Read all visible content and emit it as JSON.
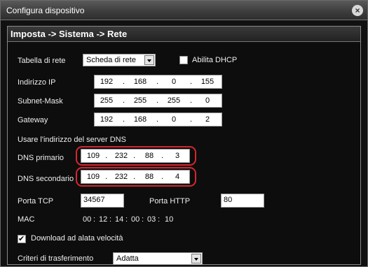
{
  "window": {
    "title": "Configura dispositivo",
    "close_icon": "close-icon"
  },
  "breadcrumb": "Imposta -> Sistema -> Rete",
  "tabella_di_rete": {
    "label": "Tabella di rete",
    "value": "Scheda di rete"
  },
  "dhcp": {
    "label": "Abilita DHCP",
    "checked": false
  },
  "ip": {
    "label": "Indirizzo IP",
    "octets": [
      "192",
      "168",
      "0",
      "155"
    ]
  },
  "subnet": {
    "label": "Subnet-Mask",
    "octets": [
      "255",
      "255",
      "255",
      "0"
    ]
  },
  "gateway": {
    "label": "Gateway",
    "octets": [
      "192",
      "168",
      "0",
      "2"
    ]
  },
  "dns_section_label": "Usare l'indirizzo del server DNS",
  "dns_primary": {
    "label": "DNS primario",
    "octets": [
      "109",
      "232",
      "88",
      "3"
    ]
  },
  "dns_secondary": {
    "label": "DNS secondario",
    "octets": [
      "109",
      "232",
      "88",
      "4"
    ]
  },
  "porta_tcp": {
    "label": "Porta TCP",
    "value": "34567"
  },
  "porta_http": {
    "label": "Porta HTTP",
    "value": "80"
  },
  "mac": {
    "label": "MAC",
    "parts": [
      "00",
      "12",
      "14",
      "00",
      "03",
      "10"
    ]
  },
  "download": {
    "label": "Download ad alata velocità",
    "checked": true
  },
  "criteri": {
    "label": "Criteri di trasferimento",
    "value": "Adatta"
  },
  "colors": {
    "highlight": "#d6262e",
    "background": "#111111"
  }
}
